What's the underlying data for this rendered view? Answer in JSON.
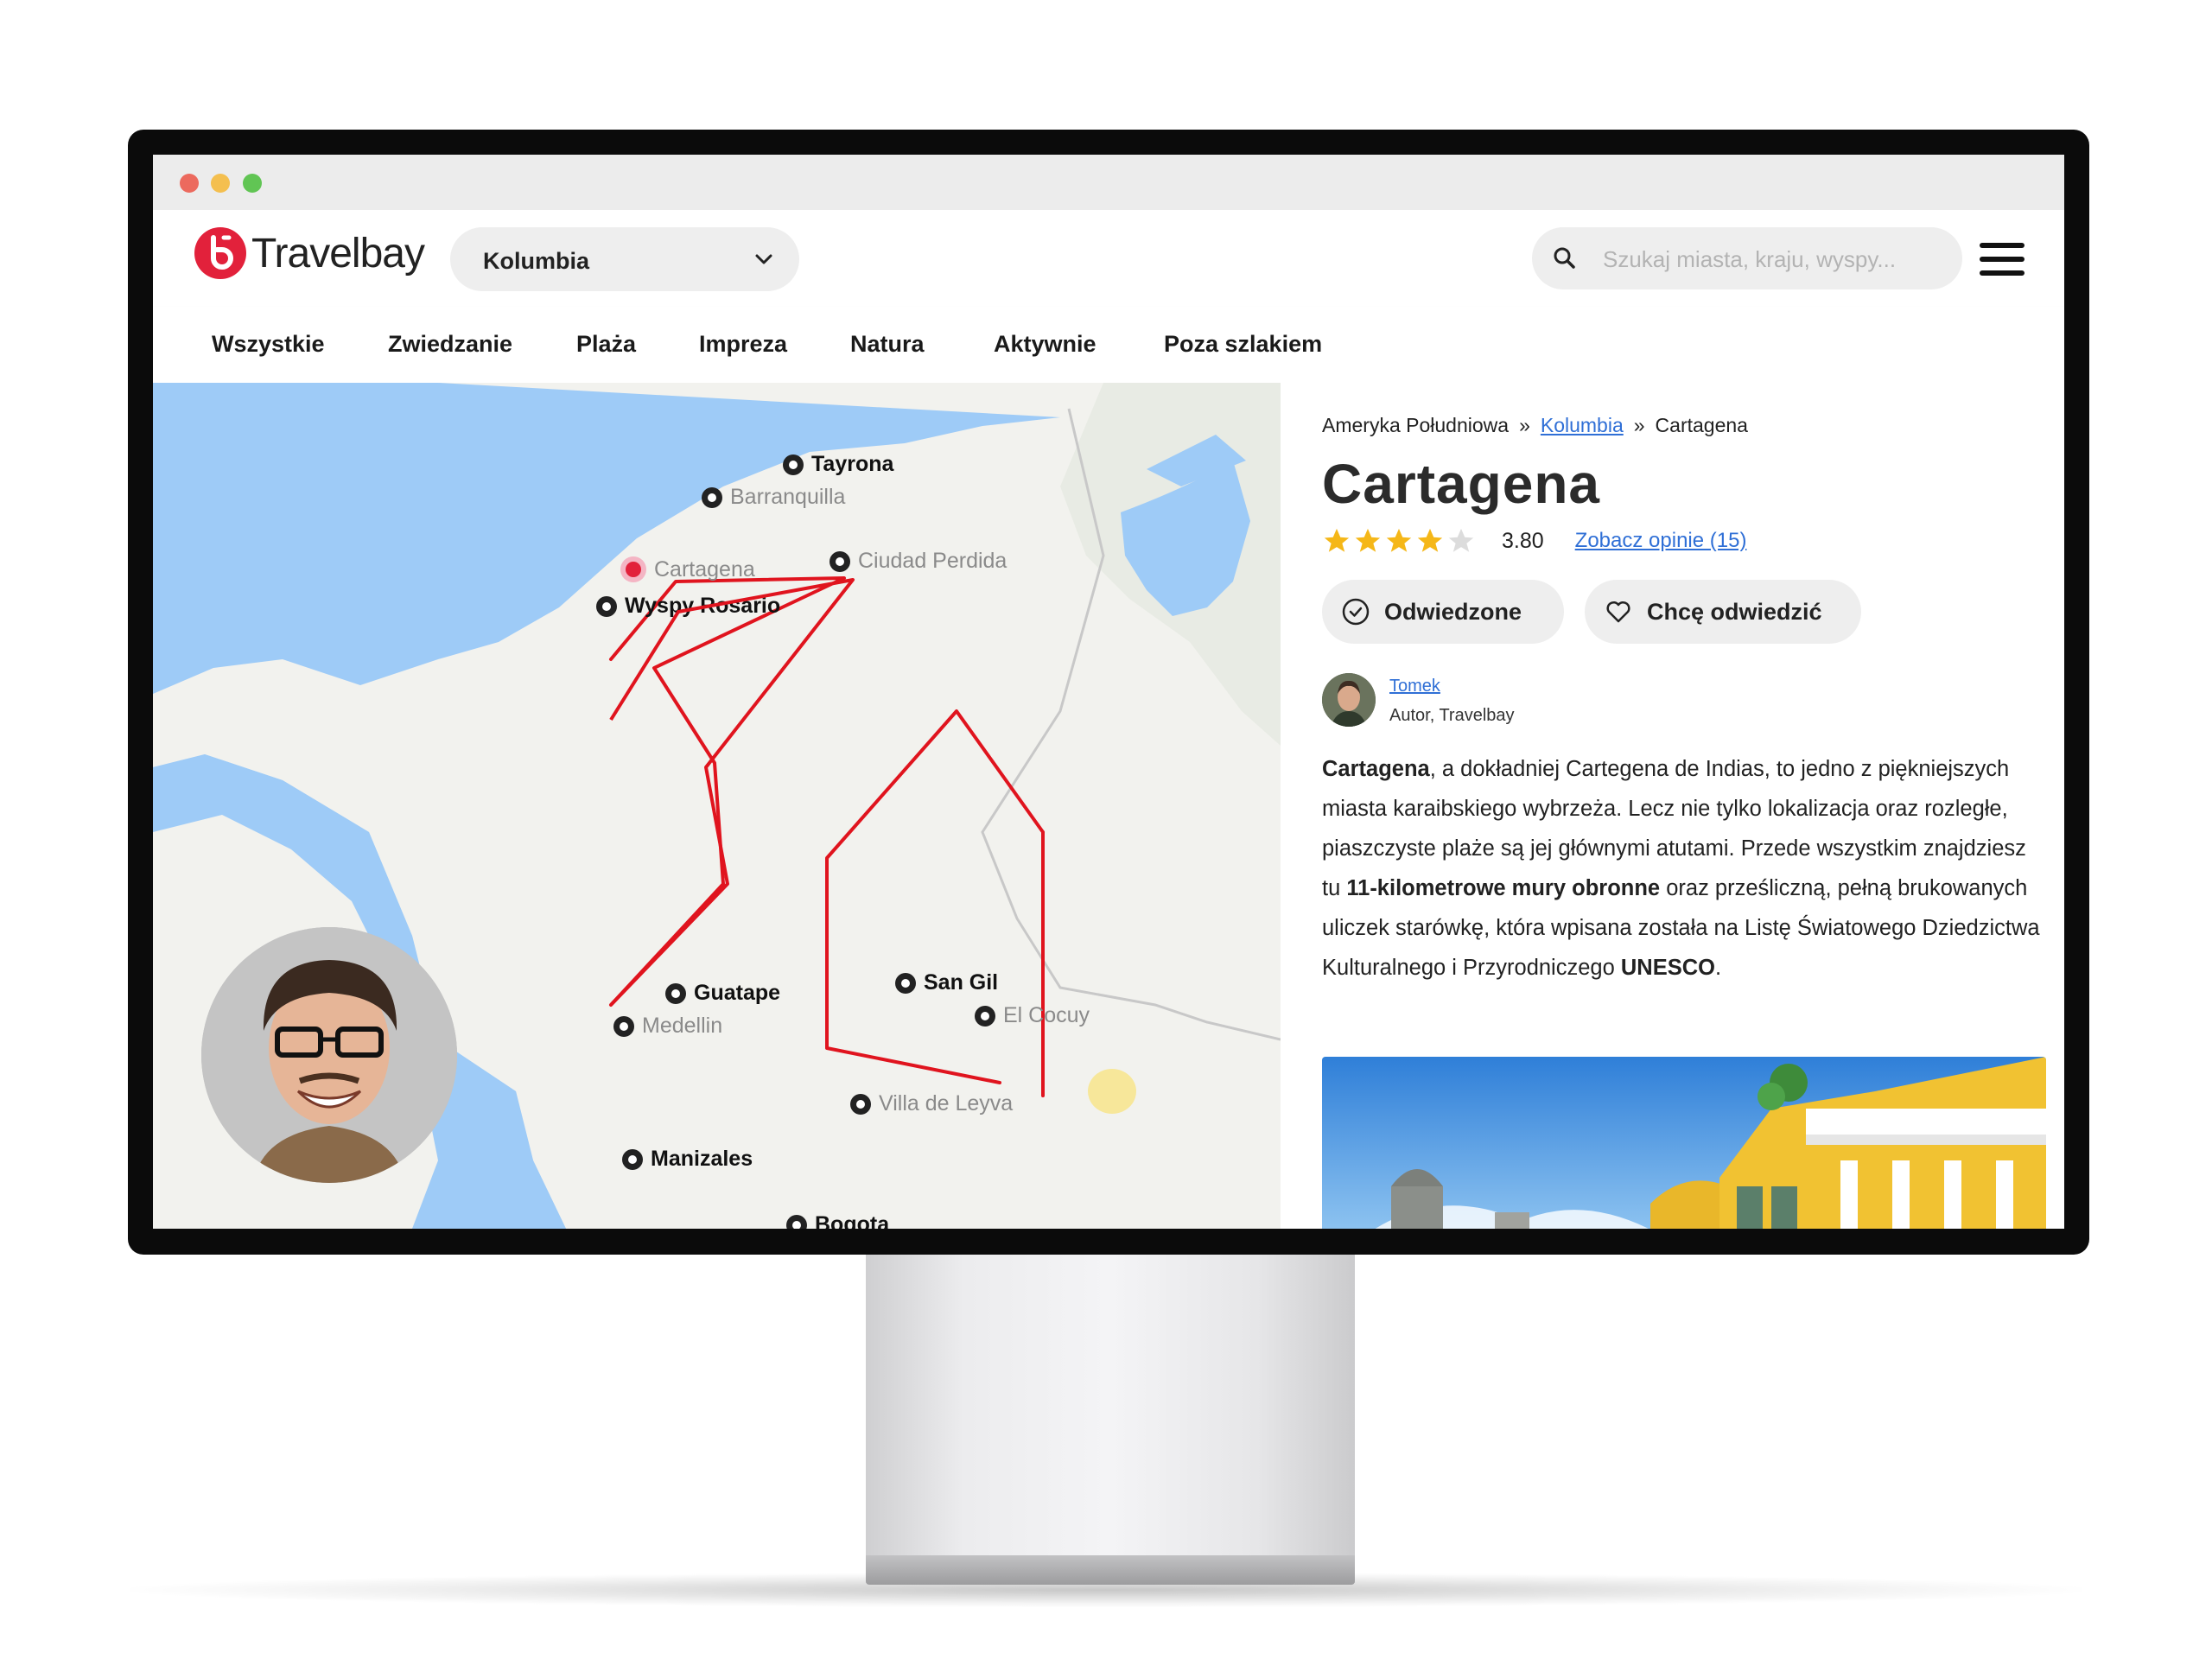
{
  "app": {
    "brand": "Travelbay",
    "accent_color": "#e2213b",
    "link_color": "#2f6fd6"
  },
  "header": {
    "country_selector": {
      "value": "Kolumbia"
    },
    "search": {
      "placeholder": "Szukaj miasta, kraju, wyspy..."
    }
  },
  "nav": {
    "items": [
      {
        "label": "Wszystkie"
      },
      {
        "label": "Zwiedzanie"
      },
      {
        "label": "Plaża"
      },
      {
        "label": "Impreza"
      },
      {
        "label": "Natura"
      },
      {
        "label": "Aktywnie"
      },
      {
        "label": "Poza szlakiem"
      }
    ]
  },
  "map": {
    "places": [
      {
        "name": "Tayrona",
        "style": "bold"
      },
      {
        "name": "Barranquilla",
        "style": "faded"
      },
      {
        "name": "Cartagena",
        "style": "selected"
      },
      {
        "name": "Ciudad Perdida",
        "style": "faded"
      },
      {
        "name": "Wyspy Rosario",
        "style": "bold"
      },
      {
        "name": "Guatape",
        "style": "bold"
      },
      {
        "name": "Medellin",
        "style": "faded"
      },
      {
        "name": "San Gil",
        "style": "bold"
      },
      {
        "name": "El Cocuy",
        "style": "faded"
      },
      {
        "name": "Villa de Leyva",
        "style": "faded"
      },
      {
        "name": "Manizales",
        "style": "bold"
      },
      {
        "name": "Bogota",
        "style": "bold"
      }
    ],
    "annotation_color": "#e0141e",
    "water_color": "#9ecbf7",
    "land_color": "#f2f2ee"
  },
  "panel": {
    "breadcrumb": [
      "Ameryka Południowa",
      "Kolumbia",
      "Cartagena"
    ],
    "breadcrumb_sep": "»",
    "title": "Cartagena",
    "rating": {
      "value": "3.80",
      "stars_filled": 4,
      "stars_total": 5,
      "reviews_link": "Zobacz opinie (15)"
    },
    "buttons": {
      "visited": "Odwiedzone",
      "want": "Chcę odwiedzić"
    },
    "author": {
      "name": "Tomek",
      "role": "Autor, Travelbay"
    },
    "description": {
      "p1_bold": "Cartagena",
      "p1_a": ", a dokładniej Cartegena de Indias, to jedno z piękniejszych miasta karaibskiego wybrzeża. Lecz nie tylko lokalizacja oraz rozległe, piaszczyste plaże są jej głównymi atutami. Przede wszystkim znajdziesz tu ",
      "p1_bold2": "11-kilometrowe mury obronne",
      "p1_b": " oraz prześliczną, pełną brukowanych uliczek starówkę, która wpisana została na Listę Światowego Dziedzictwa Kulturalnego i Przyrodniczego ",
      "p1_bold3": "UNESCO",
      "p1_c": "."
    }
  }
}
